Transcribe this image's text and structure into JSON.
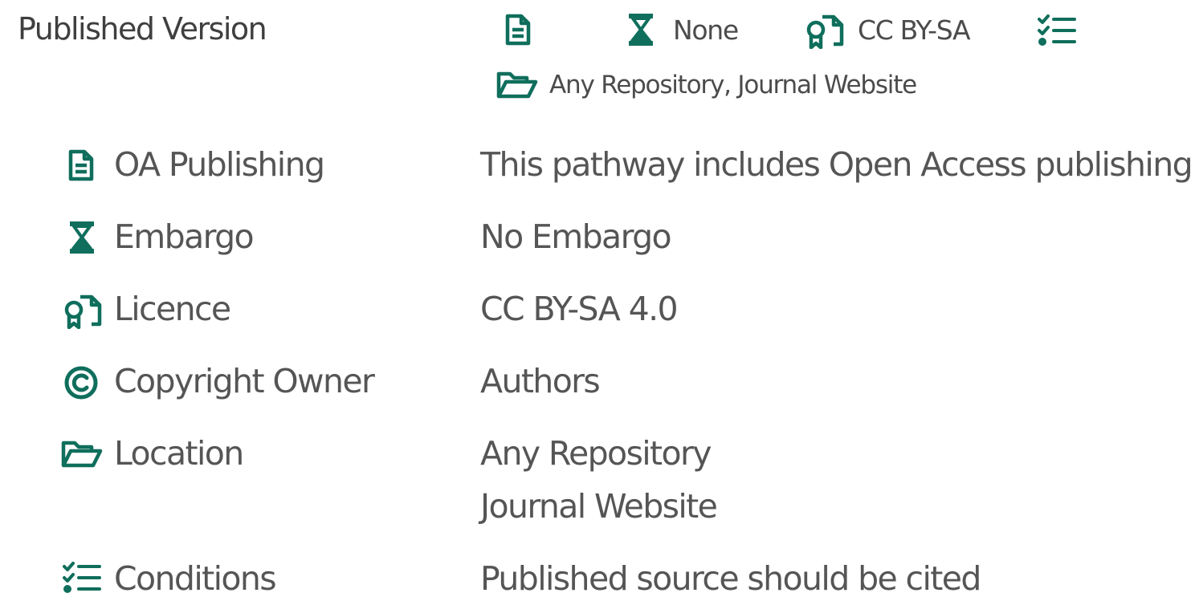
{
  "header": {
    "title": "Published Version",
    "summary": {
      "oa_icon": "document-icon",
      "embargo_icon": "hourglass-icon",
      "embargo_value": "None",
      "licence_icon": "licence-certificate-icon",
      "licence_value": "CC BY-SA",
      "conditions_icon": "checklist-icon",
      "location_icon": "folder-open-icon",
      "location_value": "Any Repository, Journal Website"
    }
  },
  "rows": [
    {
      "icon": "document-icon",
      "label": "OA Publishing",
      "values": [
        "This pathway includes Open Access publishing"
      ]
    },
    {
      "icon": "hourglass-icon",
      "label": "Embargo",
      "values": [
        "No Embargo"
      ]
    },
    {
      "icon": "licence-certificate-icon",
      "label": "Licence",
      "values": [
        "CC BY-SA 4.0"
      ]
    },
    {
      "icon": "copyright-icon",
      "label": "Copyright Owner",
      "values": [
        "Authors"
      ]
    },
    {
      "icon": "folder-open-icon",
      "label": "Location",
      "values": [
        "Any Repository",
        "Journal Website"
      ]
    },
    {
      "icon": "checklist-icon",
      "label": "Conditions",
      "values": [
        "Published source should be cited"
      ]
    }
  ],
  "colors": {
    "accent": "#0f6e5c",
    "text": "#555555"
  }
}
